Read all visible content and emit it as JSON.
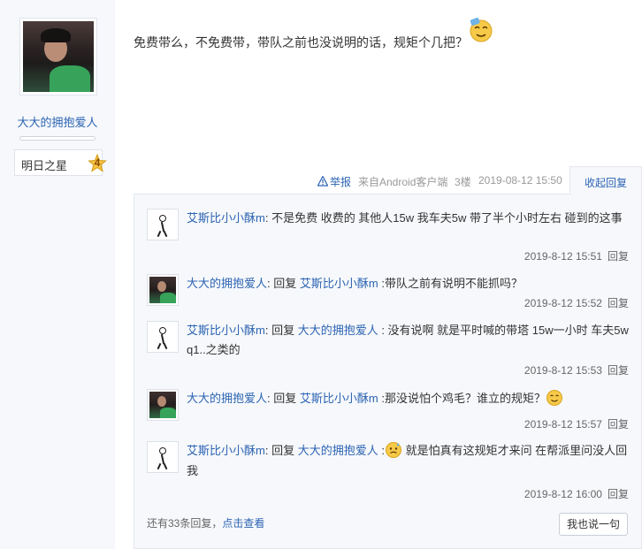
{
  "author": {
    "username": "大大的拥抱爱人",
    "level_name": "明日之星",
    "level": "4",
    "experience_progress": 0.0
  },
  "post": {
    "text": "免费带么，不免费带，带队之前也没说明的话，规矩个几把？",
    "emoji": "smile-emoji",
    "report_label": "举报",
    "source": "来自Android客户端",
    "floor": "3楼",
    "time": "2019-08-12 15:50"
  },
  "collapse_label": "收起回复",
  "replies": [
    {
      "user": "艾斯比小小酥m",
      "avatar": "stick-figure",
      "prefix": ":",
      "reply_to_label": "",
      "reply_to": "",
      "text": " 不是免费 收费的 其他人15w 我车夫5w 带了半个小时左右 碰到的这事",
      "time": "2019-8-12 15:51",
      "reply_label": "回复"
    },
    {
      "user": "大大的拥抱爱人",
      "avatar": "couple",
      "prefix": ":",
      "reply_to_label": " 回复 ",
      "reply_to": "艾斯比小小酥m",
      "text": " :带队之前有说明不能抓吗？",
      "time": "2019-8-12 15:52",
      "reply_label": "回复"
    },
    {
      "user": "艾斯比小小酥m",
      "avatar": "stick-figure",
      "prefix": ":",
      "reply_to_label": " 回复 ",
      "reply_to": "大大的拥抱爱人",
      "text": " : 没有说啊 就是平时喊的带塔 15w一小时 车夫5w q1..之类的",
      "time": "2019-8-12 15:53",
      "reply_label": "回复"
    },
    {
      "user": "大大的拥抱爱人",
      "avatar": "couple",
      "prefix": ":",
      "reply_to_label": " 回复 ",
      "reply_to": "艾斯比小小酥m",
      "text": " :那没说怕个鸡毛？谁立的规矩？",
      "time": "2019-8-12 15:57",
      "reply_label": "回复"
    },
    {
      "user": "艾斯比小小酥m",
      "avatar": "stick-figure",
      "prefix": ":",
      "reply_to_label": " 回复 ",
      "reply_to": "大大的拥抱爱人",
      "text": " 就是怕真有这规矩才来问 在帮派里问没人回我",
      "time": "2019-8-12 16:00",
      "reply_label": "回复"
    }
  ],
  "more": {
    "count_text": "还有33条回复，",
    "link_text": "点击查看"
  },
  "say_button": "我也说一句",
  "colors": {
    "link": "#2d64b3",
    "panel_bg": "#f6f8fb",
    "sidebar_bg": "#f6f8fb"
  }
}
